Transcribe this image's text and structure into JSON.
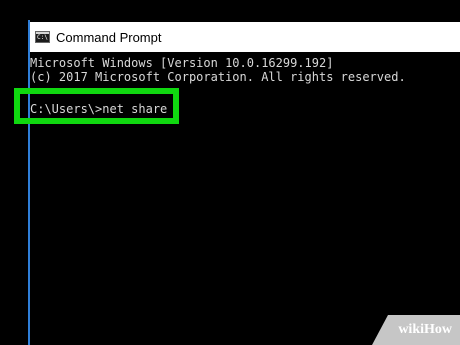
{
  "window": {
    "title": "Command Prompt",
    "icon": "cmd-icon",
    "icon_text": "C:\\"
  },
  "console": {
    "lines": [
      "Microsoft Windows [Version 10.0.16299.192]",
      "(c) 2017 Microsoft Corporation. All rights reserved."
    ],
    "prompt_line": "C:\\Users\\>net share"
  },
  "highlight": {
    "color": "#10d810"
  },
  "watermark": {
    "text": "wikiHow"
  }
}
